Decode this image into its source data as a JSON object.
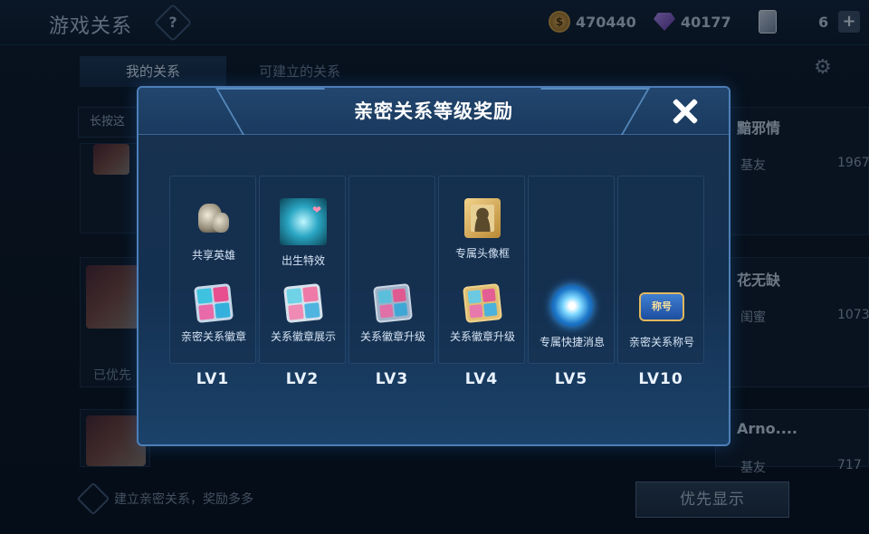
{
  "header": {
    "title": "游戏关系",
    "help_label": "?",
    "gold": "470440",
    "diamonds": "40177",
    "cards": "6"
  },
  "tabs": [
    {
      "label": "我的关系"
    },
    {
      "label": "可建立的关系"
    }
  ],
  "background": {
    "sort_hint": "长按这",
    "right_list": [
      {
        "name": "黯邪情",
        "type": "基友",
        "value": "1967"
      },
      {
        "name": "花无缺",
        "type": "闺蜜",
        "value": "1073"
      },
      {
        "name": "Arno....",
        "type": "基友",
        "value": "717"
      }
    ],
    "left_status": "已优先",
    "bottom_hint": "建立亲密关系，奖励多多",
    "priority_button": "优先显示"
  },
  "modal": {
    "title": "亲密关系等级奖励",
    "levels": [
      {
        "level": "LV1",
        "reward1": "共享英雄",
        "reward2": "亲密关系徽章"
      },
      {
        "level": "LV2",
        "reward1": "出生特效",
        "reward2": "关系徽章展示"
      },
      {
        "level": "LV3",
        "reward1": "",
        "reward2": "关系徽章升级"
      },
      {
        "level": "LV4",
        "reward1": "专属头像框",
        "reward2": "关系徽章升级"
      },
      {
        "level": "LV5",
        "reward1": "",
        "reward2": "专属快捷消息"
      },
      {
        "level": "LV10",
        "reward1": "",
        "reward2": "亲密关系称号"
      }
    ],
    "title_scroll_text": "称号"
  },
  "colors": {
    "modal_border": "#4d7fb7",
    "modal_bg": "#18314f",
    "accent_text": "#ffffff"
  }
}
